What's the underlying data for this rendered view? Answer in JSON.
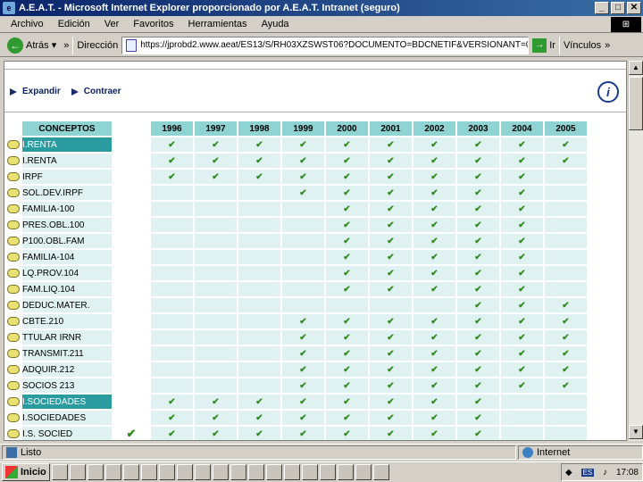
{
  "window": {
    "title": "A.E.A.T. - Microsoft Internet Explorer proporcionado por A.E.A.T. Intranet (seguro)"
  },
  "menu": [
    "Archivo",
    "Edición",
    "Ver",
    "Favoritos",
    "Herramientas",
    "Ayuda"
  ],
  "toolbar": {
    "back_label": "Atrás",
    "address_label": "Dirección",
    "url": "https://jprobd2.www.aeat/ES13/S/RH03XZSWST06?DOCUMENTO=BDCNETIF&VERSIONANT=0C1&T",
    "go_label": "Ir",
    "links_label": "Vínculos"
  },
  "page": {
    "expand_label": "Expandir",
    "collapse_label": "Contraer",
    "concepts_header": "CONCEPTOS",
    "years": [
      "1996",
      "1997",
      "1998",
      "1999",
      "2000",
      "2001",
      "2002",
      "2003",
      "2004",
      "2005"
    ],
    "check_mark": "✔",
    "rows": [
      {
        "name": "I.RENTA",
        "group": true,
        "gap_check": false,
        "checks": [
          0,
          1,
          1,
          1,
          1,
          1,
          1,
          1,
          1,
          1,
          1
        ]
      },
      {
        "name": "I.RENTA",
        "group": false,
        "gap_check": false,
        "checks": [
          0,
          1,
          1,
          1,
          1,
          1,
          1,
          1,
          1,
          1,
          1
        ]
      },
      {
        "name": "IRPF",
        "group": false,
        "gap_check": false,
        "checks": [
          0,
          1,
          1,
          1,
          1,
          1,
          1,
          1,
          1,
          1,
          0
        ]
      },
      {
        "name": "SOL.DEV.IRPF",
        "group": false,
        "gap_check": false,
        "checks": [
          0,
          0,
          0,
          0,
          1,
          1,
          1,
          1,
          1,
          1,
          0
        ]
      },
      {
        "name": "FAMILIA-100",
        "group": false,
        "gap_check": false,
        "checks": [
          0,
          0,
          0,
          0,
          0,
          1,
          1,
          1,
          1,
          1,
          0
        ]
      },
      {
        "name": "PRES.OBL.100",
        "group": false,
        "gap_check": false,
        "checks": [
          0,
          0,
          0,
          0,
          0,
          1,
          1,
          1,
          1,
          1,
          0
        ]
      },
      {
        "name": "P100.OBL.FAM",
        "group": false,
        "gap_check": false,
        "checks": [
          0,
          0,
          0,
          0,
          0,
          1,
          1,
          1,
          1,
          1,
          0
        ]
      },
      {
        "name": "FAMILIA-104",
        "group": false,
        "gap_check": false,
        "checks": [
          0,
          0,
          0,
          0,
          0,
          1,
          1,
          1,
          1,
          1,
          0
        ]
      },
      {
        "name": "LQ.PROV.104",
        "group": false,
        "gap_check": false,
        "checks": [
          0,
          0,
          0,
          0,
          0,
          1,
          1,
          1,
          1,
          1,
          0
        ]
      },
      {
        "name": "FAM.LIQ.104",
        "group": false,
        "gap_check": false,
        "checks": [
          0,
          0,
          0,
          0,
          0,
          1,
          1,
          1,
          1,
          1,
          0
        ]
      },
      {
        "name": "DEDUC.MATER.",
        "group": false,
        "gap_check": false,
        "checks": [
          0,
          0,
          0,
          0,
          0,
          0,
          0,
          0,
          1,
          1,
          1
        ]
      },
      {
        "name": "CBTE.210",
        "group": false,
        "gap_check": false,
        "checks": [
          0,
          0,
          0,
          0,
          1,
          1,
          1,
          1,
          1,
          1,
          1
        ]
      },
      {
        "name": "TTULAR IRNR",
        "group": false,
        "gap_check": false,
        "checks": [
          0,
          0,
          0,
          0,
          1,
          1,
          1,
          1,
          1,
          1,
          1
        ]
      },
      {
        "name": "TRANSMIT.211",
        "group": false,
        "gap_check": false,
        "checks": [
          0,
          0,
          0,
          0,
          1,
          1,
          1,
          1,
          1,
          1,
          1
        ]
      },
      {
        "name": "ADQUIR.212",
        "group": false,
        "gap_check": false,
        "checks": [
          0,
          0,
          0,
          0,
          1,
          1,
          1,
          1,
          1,
          1,
          1
        ]
      },
      {
        "name": "SOCIOS 213",
        "group": false,
        "gap_check": false,
        "checks": [
          0,
          0,
          0,
          0,
          1,
          1,
          1,
          1,
          1,
          1,
          1
        ]
      },
      {
        "name": "I.SOCIEDADES",
        "group": true,
        "gap_check": false,
        "checks": [
          0,
          1,
          1,
          1,
          1,
          1,
          1,
          1,
          1,
          0,
          0
        ]
      },
      {
        "name": "I.SOCIEDADES",
        "group": false,
        "gap_check": false,
        "checks": [
          0,
          1,
          1,
          1,
          1,
          1,
          1,
          1,
          1,
          0,
          0
        ]
      },
      {
        "name": "I.S. SOCIED",
        "group": false,
        "gap_check": true,
        "checks": [
          0,
          1,
          1,
          1,
          1,
          1,
          1,
          1,
          1,
          0,
          0
        ]
      }
    ]
  },
  "status": {
    "left_text": "Listo",
    "zone_text": "Internet"
  },
  "taskbar": {
    "start_label": "Inicio",
    "clock": "17:08",
    "lang": "ES"
  }
}
